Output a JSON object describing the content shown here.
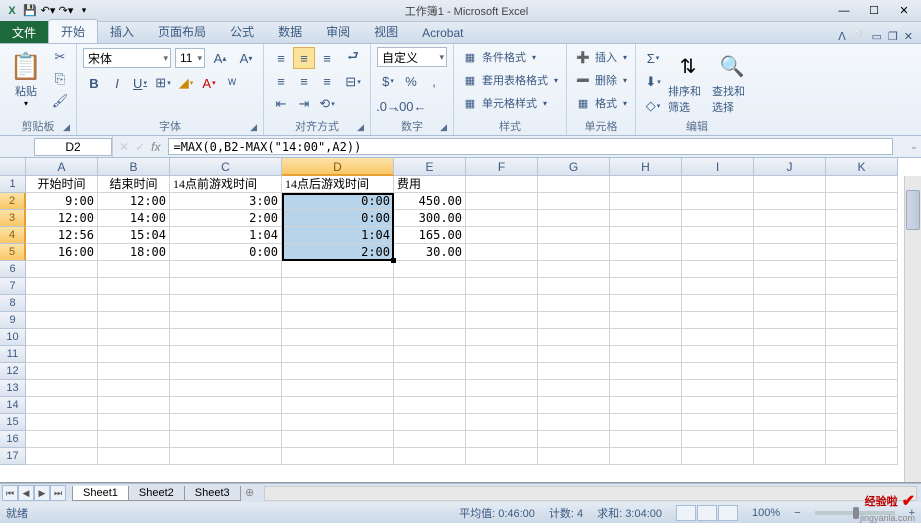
{
  "title": "工作簿1 - Microsoft Excel",
  "tabs": {
    "file": "文件",
    "items": [
      "开始",
      "插入",
      "页面布局",
      "公式",
      "数据",
      "审阅",
      "视图",
      "Acrobat"
    ],
    "active": 0
  },
  "ribbon": {
    "clipboard": {
      "label": "剪贴板",
      "paste": "粘贴"
    },
    "font": {
      "label": "字体",
      "name": "宋体",
      "size": "11"
    },
    "align": {
      "label": "对齐方式"
    },
    "number": {
      "label": "数字",
      "format": "自定义"
    },
    "styles": {
      "label": "样式",
      "cond": "条件格式",
      "table": "套用表格格式",
      "cell": "单元格样式"
    },
    "cells": {
      "label": "单元格",
      "insert": "插入",
      "delete": "删除",
      "format": "格式"
    },
    "editing": {
      "label": "编辑",
      "sort": "排序和筛选",
      "find": "查找和选择"
    }
  },
  "namebox": "D2",
  "formula": "=MAX(0,B2-MAX(\"14:00\",A2))",
  "columns": [
    "A",
    "B",
    "C",
    "D",
    "E",
    "F",
    "G",
    "H",
    "I",
    "J",
    "K"
  ],
  "headers": [
    "开始时间",
    "结束时间",
    "14点前游戏时间",
    "14点后游戏时间",
    "费用"
  ],
  "data_rows": [
    {
      "a": "9:00",
      "b": "12:00",
      "c": "3:00",
      "d": "0:00",
      "e": "450.00"
    },
    {
      "a": "12:00",
      "b": "14:00",
      "c": "2:00",
      "d": "0:00",
      "e": "300.00"
    },
    {
      "a": "12:56",
      "b": "15:04",
      "c": "1:04",
      "d": "1:04",
      "e": "165.00"
    },
    {
      "a": "16:00",
      "b": "18:00",
      "c": "0:00",
      "d": "2:00",
      "e": "30.00"
    }
  ],
  "chart_data": {
    "type": "table",
    "columns": [
      "开始时间",
      "结束时间",
      "14点前游戏时间",
      "14点后游戏时间",
      "费用"
    ],
    "rows": [
      [
        "9:00",
        "12:00",
        "3:00",
        "0:00",
        450.0
      ],
      [
        "12:00",
        "14:00",
        "2:00",
        "0:00",
        300.0
      ],
      [
        "12:56",
        "15:04",
        "1:04",
        "1:04",
        165.0
      ],
      [
        "16:00",
        "18:00",
        "0:00",
        "2:00",
        30.0
      ]
    ]
  },
  "sheets": [
    "Sheet1",
    "Sheet2",
    "Sheet3"
  ],
  "status": {
    "ready": "就绪",
    "avg_label": "平均值:",
    "avg": "0:46:00",
    "count_label": "计数:",
    "count": "4",
    "sum_label": "求和:",
    "sum": "3:04:00",
    "zoom": "100%"
  },
  "watermark": {
    "brand": "经验啦",
    "url": "jingyanla.com"
  }
}
